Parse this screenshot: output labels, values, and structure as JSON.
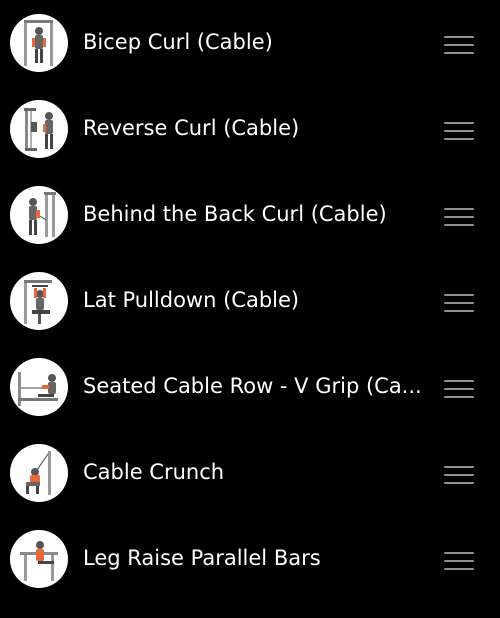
{
  "exercises": [
    {
      "name": "Bicep Curl (Cable)",
      "icon": "bicep-curl-cable-thumbnail"
    },
    {
      "name": "Reverse Curl (Cable)",
      "icon": "reverse-curl-cable-thumbnail"
    },
    {
      "name": "Behind the Back Curl (Cable)",
      "icon": "behind-the-back-curl-cable-thumbnail"
    },
    {
      "name": "Lat Pulldown (Cable)",
      "icon": "lat-pulldown-cable-thumbnail"
    },
    {
      "name": "Seated Cable Row - V Grip (Ca...",
      "icon": "seated-cable-row-thumbnail"
    },
    {
      "name": "Cable Crunch",
      "icon": "cable-crunch-thumbnail"
    },
    {
      "name": "Leg Raise Parallel Bars",
      "icon": "leg-raise-parallel-bars-thumbnail"
    }
  ],
  "colors": {
    "background": "#000000",
    "text": "#ffffff",
    "drag_handle": "#8e8e93",
    "thumbnail_background": "#ffffff",
    "muscle_highlight": "#e8683c"
  }
}
